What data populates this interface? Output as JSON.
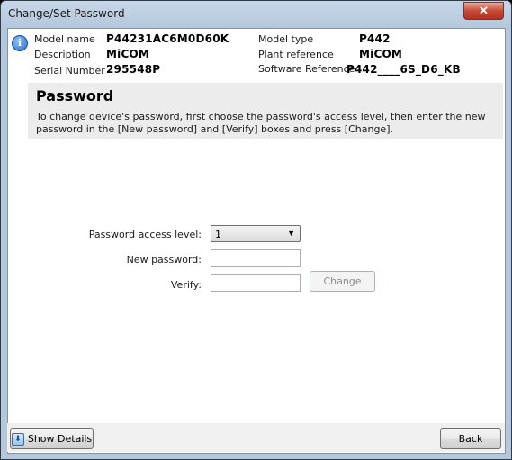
{
  "window": {
    "title": "Change/Set Password",
    "close_glyph": "✕"
  },
  "device_info": {
    "model_name_label": "Model name",
    "model_name": "P44231AC6M0D60K",
    "description_label": "Description",
    "description": "MiCOM",
    "serial_label": "Serial Number",
    "serial": "295548P",
    "model_type_label": "Model type",
    "model_type": "P442",
    "plant_reference_label": "Plant reference",
    "plant_reference": "MiCOM",
    "software_reference_label": "Software Reference",
    "software_reference": "P442____6S_D6_KB"
  },
  "password_section": {
    "heading": "Password",
    "description": "To change device's password, first choose the password's access level, then enter the new password in the [New password] and [Verify] boxes and press [Change]."
  },
  "form": {
    "access_level_label": "Password access level:",
    "access_level_value": "1",
    "new_password_label": "New password:",
    "new_password_value": "",
    "verify_label": "Verify:",
    "verify_value": "",
    "change_button": "Change"
  },
  "footer": {
    "show_details_button": "Show Details",
    "back_button": "Back"
  },
  "icons": {
    "info": "info-icon",
    "close": "close-icon",
    "dropdown": "chevron-down-icon",
    "show_details": "arrow-down-icon"
  }
}
